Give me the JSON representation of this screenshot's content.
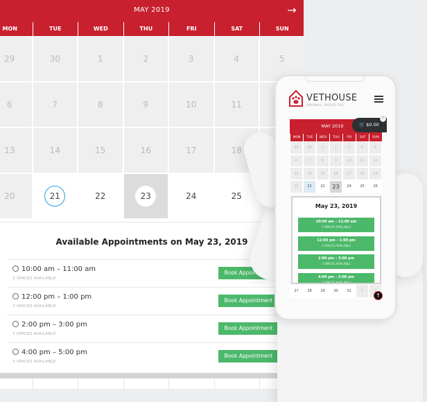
{
  "calendar": {
    "month": "MAY 2019",
    "next_icon": "arrow-right-icon",
    "weekdays": [
      "MON",
      "TUE",
      "WED",
      "THU",
      "FRI",
      "SAT",
      "SUN"
    ],
    "weeks": [
      [
        {
          "d": "29"
        },
        {
          "d": "30"
        },
        {
          "d": "1"
        },
        {
          "d": "2"
        },
        {
          "d": "3"
        },
        {
          "d": "4"
        },
        {
          "d": "5"
        }
      ],
      [
        {
          "d": "6"
        },
        {
          "d": "7"
        },
        {
          "d": "8"
        },
        {
          "d": "9"
        },
        {
          "d": "10"
        },
        {
          "d": "11"
        },
        {
          "d": "12"
        }
      ],
      [
        {
          "d": "13"
        },
        {
          "d": "14"
        },
        {
          "d": "15"
        },
        {
          "d": "16"
        },
        {
          "d": "17"
        },
        {
          "d": "18"
        },
        {
          "d": "19"
        }
      ],
      [
        {
          "d": "20"
        },
        {
          "d": "21",
          "state": "today"
        },
        {
          "d": "22",
          "state": "act"
        },
        {
          "d": "23",
          "state": "sel"
        },
        {
          "d": "24",
          "state": "act"
        },
        {
          "d": "25",
          "state": "act"
        },
        {
          "d": "26",
          "state": "act"
        }
      ],
      [
        {
          "d": "27",
          "state": "act"
        },
        {
          "d": "28",
          "state": "act"
        },
        {
          "d": "29",
          "state": "act"
        },
        {
          "d": "30",
          "state": "act"
        },
        {
          "d": "31",
          "state": "act"
        },
        {
          "d": "1"
        },
        {
          "d": "2"
        }
      ]
    ]
  },
  "appointments": {
    "title": "Available Appointments on May 23, 2019",
    "short_title": "May 23, 2019",
    "book_label": "Book Appointment",
    "slots": [
      {
        "time": "10:00 am – 11:00 am",
        "spaces": "3 SPACES AVAILABLE"
      },
      {
        "time": "12:00 pm – 1:00 pm",
        "spaces": "3 SPACES AVAILABLE"
      },
      {
        "time": "2:00 pm – 3:00 pm",
        "spaces": "3 SPACES AVAILABLE"
      },
      {
        "time": "4:00 pm – 5:00 pm",
        "spaces": "3 SPACES AVAILABLE"
      }
    ]
  },
  "phone": {
    "brand": "VETHOUSE",
    "brand_sub": "ANIMAL HOSPITAL",
    "cart_total": "$0.00",
    "cart_count": "0",
    "scroll_top_icon": "arrow-up-icon"
  },
  "colors": {
    "brand_red": "#c8202f",
    "book_green": "#4cb86a",
    "today_ring": "#27a0e0"
  }
}
